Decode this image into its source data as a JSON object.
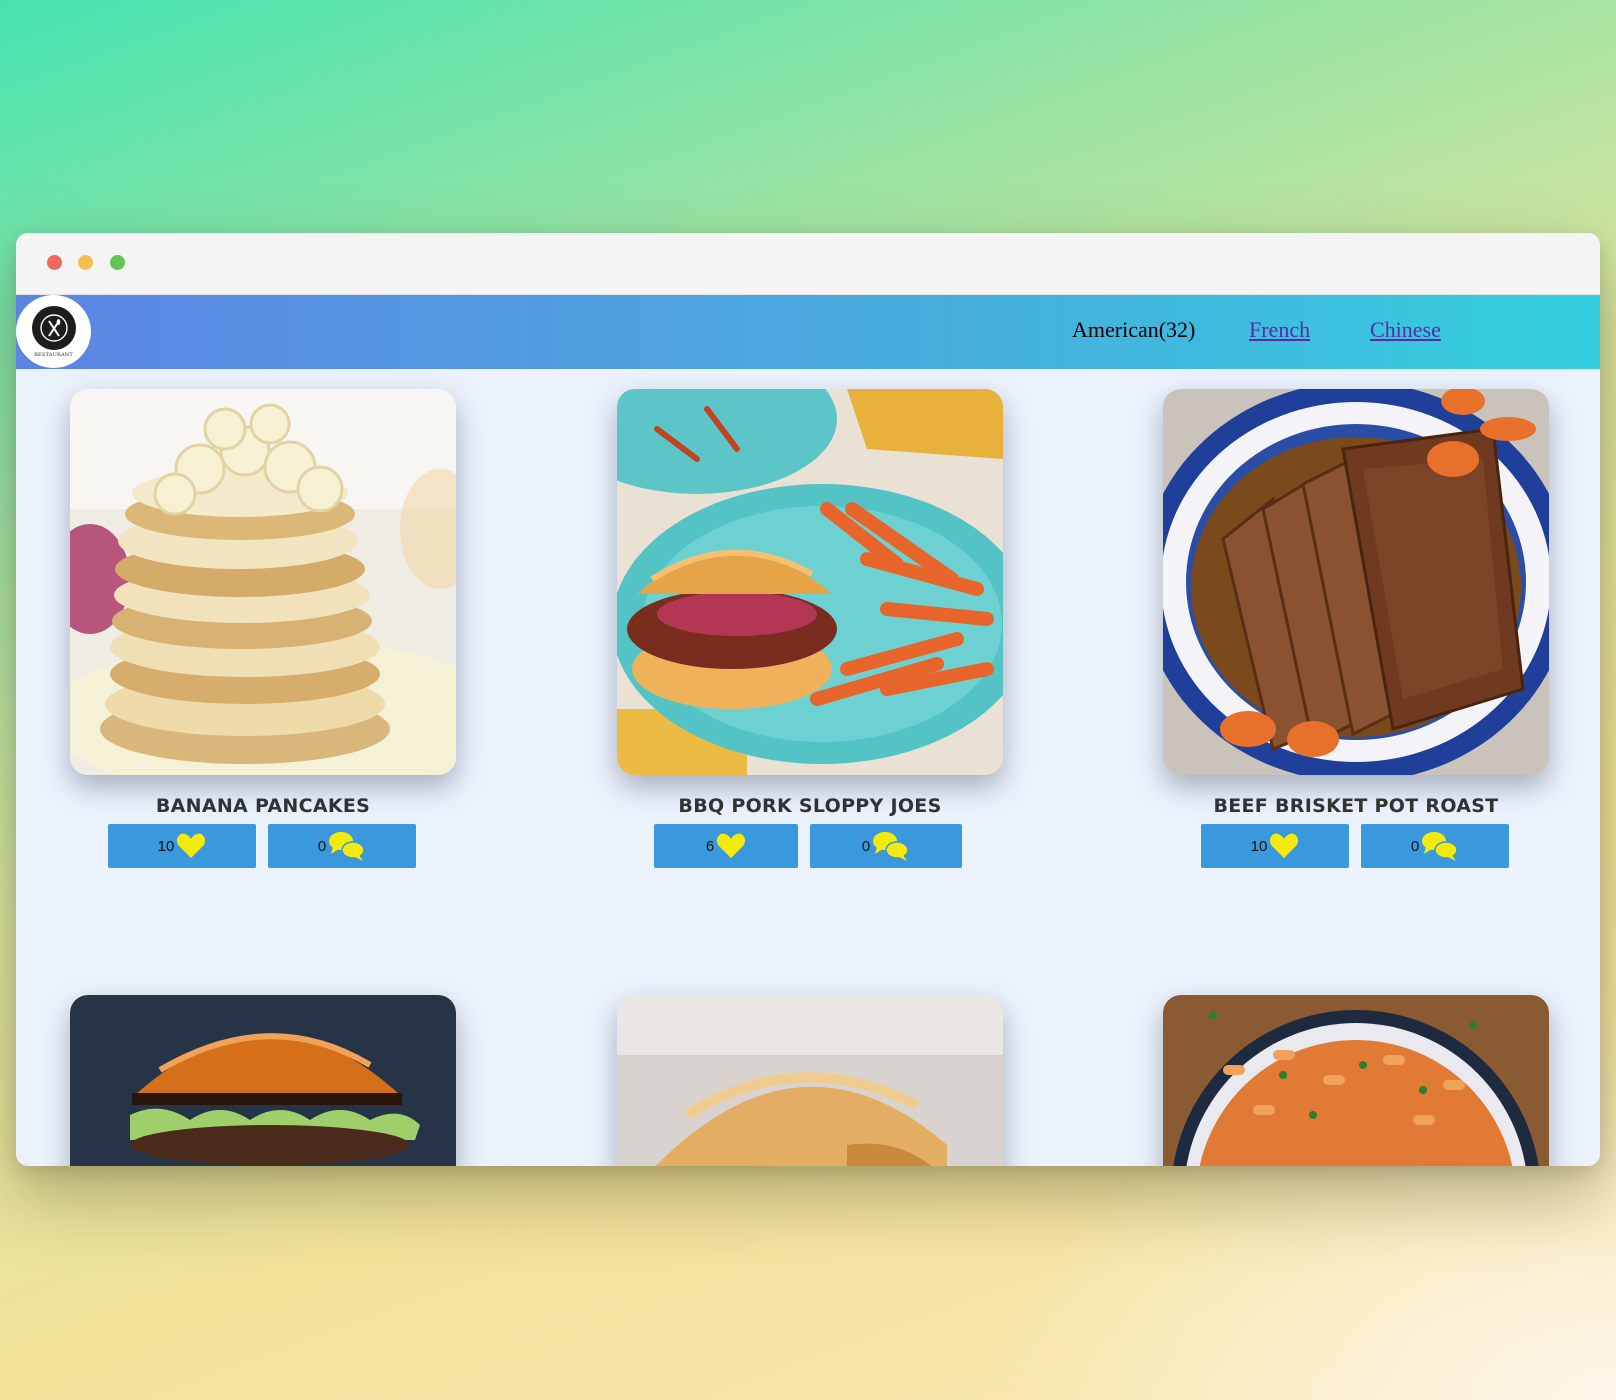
{
  "nav": {
    "logo_text": "RESTAURANT",
    "links": [
      {
        "label": "American(32)",
        "active": true
      },
      {
        "label": "French",
        "active": false
      },
      {
        "label": "Chinese",
        "active": false
      }
    ]
  },
  "icons": {
    "like": "heart-icon",
    "comments": "chat-bubbles-icon"
  },
  "colors": {
    "button": "#3a98dd",
    "icon": "#f4ea0a",
    "nav_start": "#5b84e4",
    "nav_end": "#33cfdf"
  },
  "dishes": [
    {
      "title": "Banana Pancakes",
      "likes": "10",
      "comments": "0"
    },
    {
      "title": "BBQ Pork Sloppy Joes",
      "likes": "6",
      "comments": "0"
    },
    {
      "title": "Beef Brisket Pot Roast",
      "likes": "10",
      "comments": "0"
    },
    {
      "title": "",
      "likes": "",
      "comments": ""
    },
    {
      "title": "",
      "likes": "",
      "comments": ""
    },
    {
      "title": "",
      "likes": "",
      "comments": ""
    }
  ]
}
